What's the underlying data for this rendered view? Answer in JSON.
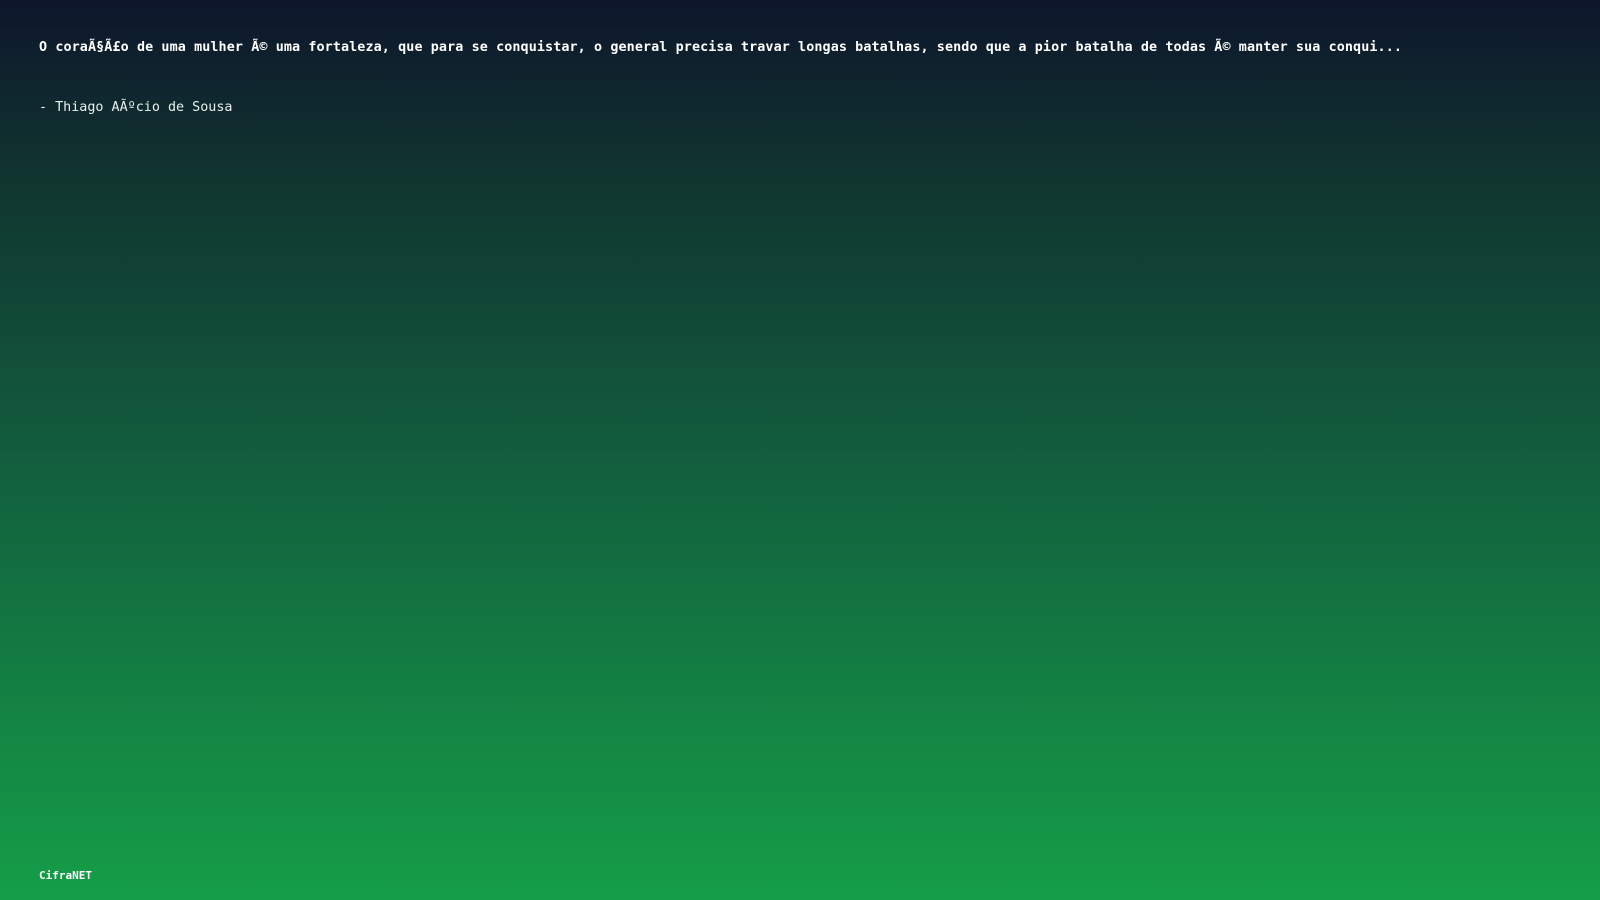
{
  "quote": {
    "text": "O coraÃ§Ã£o de uma mulher Ã© uma fortaleza, que para se conquistar, o general precisa travar longas batalhas, sendo que a pior batalha de todas Ã© manter sua conqui...",
    "author": "- Thiago AÃºcio de Sousa"
  },
  "footer": {
    "brand": "CifraNET"
  },
  "colors": {
    "gradient_top": "#0e162c",
    "gradient_bottom": "#159e48",
    "text": "#ffffff"
  }
}
